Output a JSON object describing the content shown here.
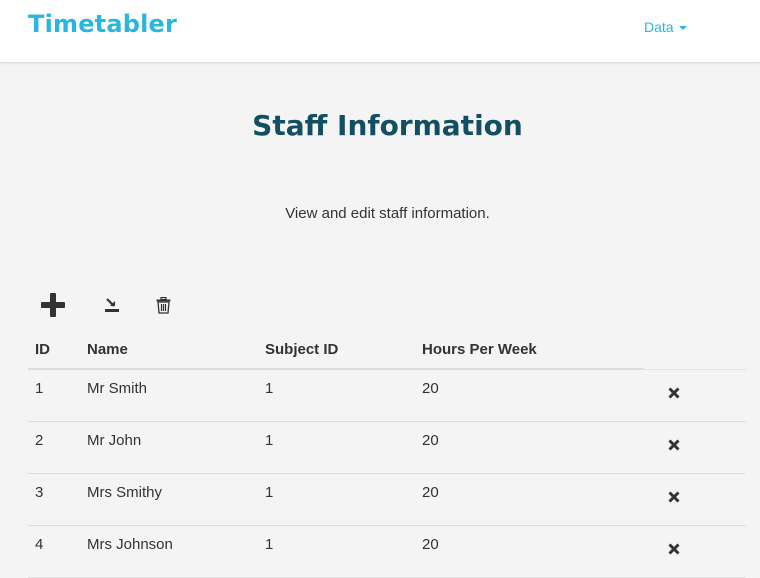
{
  "navbar": {
    "brand": "Timetabler",
    "menu_label": "Data"
  },
  "page": {
    "title": "Staff Information",
    "subtitle": "View and edit staff information."
  },
  "toolbar": {
    "icons": [
      "add-icon",
      "import-icon",
      "trash-icon"
    ]
  },
  "table": {
    "headers": {
      "id": "ID",
      "name": "Name",
      "subject_id": "Subject ID",
      "hours_per_week": "Hours Per Week"
    },
    "rows": [
      {
        "id": "1",
        "name": "Mr Smith",
        "subject_id": "1",
        "hours_per_week": "20"
      },
      {
        "id": "2",
        "name": "Mr John",
        "subject_id": "1",
        "hours_per_week": "20"
      },
      {
        "id": "3",
        "name": "Mrs Smithy",
        "subject_id": "1",
        "hours_per_week": "20"
      },
      {
        "id": "4",
        "name": "Mrs Johnson",
        "subject_id": "1",
        "hours_per_week": "20"
      }
    ]
  },
  "colors": {
    "brand": "#29b6e0",
    "title": "#124f63",
    "icon": "#333333"
  }
}
